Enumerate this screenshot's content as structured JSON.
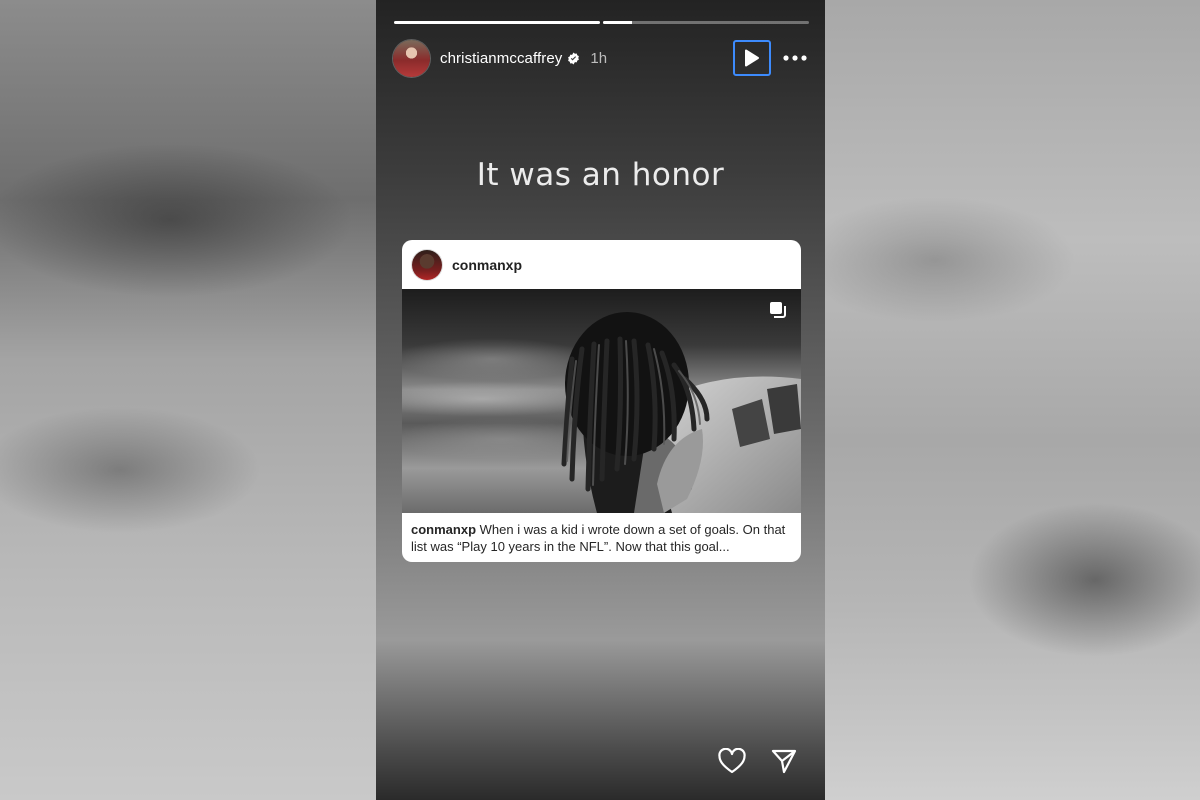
{
  "story": {
    "progress": [
      1.0,
      0.14
    ],
    "header": {
      "username": "christianmccaffrey",
      "time": "1h",
      "verified": true,
      "icons": [
        "play-icon",
        "more-icon"
      ]
    },
    "caption": "It was an honor",
    "shared_post": {
      "username": "conmanxp",
      "caption_user": "conmanxp",
      "caption_text": "When i was a kid i wrote down a set of goals. On that list was “Play 10 years in the NFL”. Now that this goal..."
    },
    "footer_icons": [
      "heart-icon",
      "send-icon"
    ]
  },
  "colors": {
    "focus_ring": "#3d8bfd",
    "text_light": "#ffffff"
  }
}
